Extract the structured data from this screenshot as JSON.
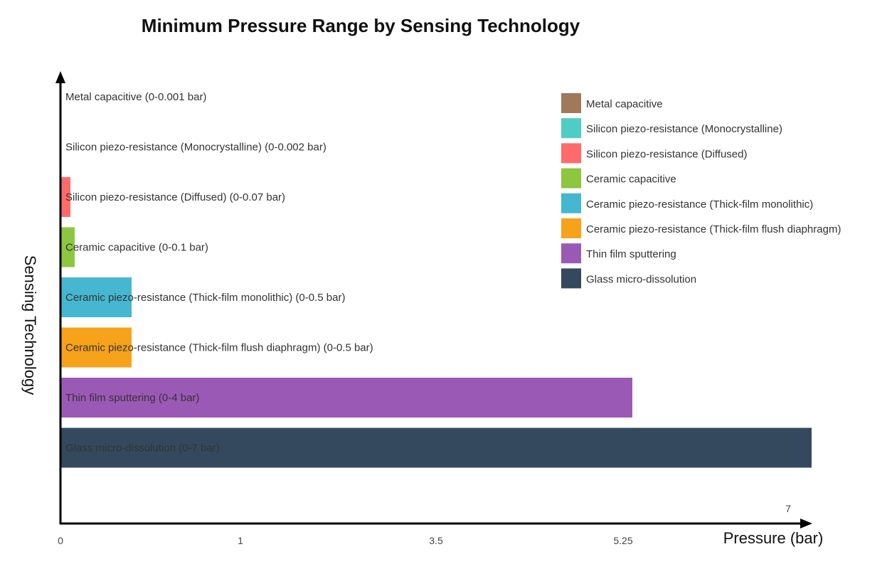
{
  "chart_data": {
    "type": "bar",
    "orientation": "horizontal",
    "title": "Minimum Pressure Range by Sensing Technology",
    "xlabel": "Pressure (bar)",
    "ylabel": "Sensing Technology",
    "xlim": [
      0,
      7
    ],
    "grid": false,
    "legend_position": "top-right",
    "x_tick_labels": [
      "0",
      "1",
      "3.5",
      "5.25",
      "7"
    ],
    "categories": [
      "Metal capacitive",
      "Silicon piezo-resistance (Monocrystalline)",
      "Silicon piezo-resistance (Diffused)",
      "Ceramic capacitive",
      "Ceramic piezo-resistance (Thick-film monolithic)",
      "Ceramic piezo-resistance (Thick-film flush diaphragm)",
      "Thin film sputtering",
      "Glass micro-dissolution"
    ],
    "values": [
      0.001,
      0.002,
      0.07,
      0.1,
      0.5,
      0.5,
      4,
      7
    ],
    "bar_labels": [
      "Metal capacitive (0-0.001 bar)",
      "Silicon piezo-resistance (Monocrystalline) (0-0.002 bar)",
      "Silicon piezo-resistance (Diffused) (0-0.07 bar)",
      "Ceramic capacitive (0-0.1 bar)",
      "Ceramic piezo-resistance (Thick-film monolithic) (0-0.5 bar)",
      "Ceramic piezo-resistance (Thick-film flush diaphragm) (0-0.5 bar)",
      "Thin film sputtering (0-4 bar)",
      "Glass micro-dissolution (0-7 bar)"
    ],
    "colors": [
      "#a0785a",
      "#4ecdc4",
      "#ff6b6b",
      "#8dc63f",
      "#45b7d1",
      "#f7a21b",
      "#9b59b6",
      "#34495e"
    ],
    "legend": [
      "Metal capacitive",
      "Silicon piezo-resistance (Monocrystalline)",
      "Silicon piezo-resistance (Diffused)",
      "Ceramic capacitive",
      "Ceramic piezo-resistance (Thick-film monolithic)",
      "Ceramic piezo-resistance (Thick-film flush diaphragm)",
      "Thin film sputtering",
      "Glass micro-dissolution"
    ]
  }
}
